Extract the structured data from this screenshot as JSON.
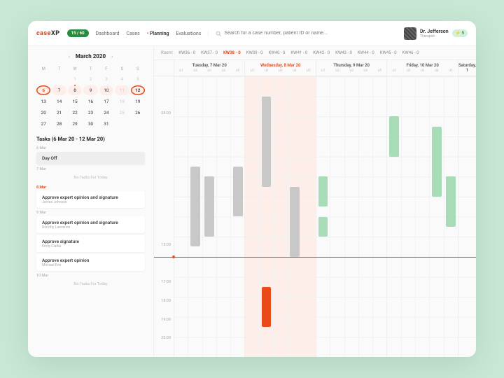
{
  "brand": {
    "part1": "case",
    "part2": "XP"
  },
  "badge_primary": "15 / 60",
  "nav": {
    "dashboard": "Dashboard",
    "cases": "Cases",
    "planning": "Planning",
    "evaluations": "Evaluations"
  },
  "search": {
    "placeholder": "Search for a case number, patient ID or name..."
  },
  "user": {
    "name": "Dr. Jefferson",
    "role": "Therapist",
    "badge": "⚡ 5"
  },
  "calendar": {
    "title": "March 2020",
    "dow": [
      "M",
      "T",
      "W",
      "T",
      "F",
      "S",
      "S"
    ],
    "days": [
      {
        "n": "",
        "t": "blank"
      },
      {
        "n": "",
        "t": "blank"
      },
      {
        "n": "1",
        "t": "muted"
      },
      {
        "n": "2",
        "t": "muted"
      },
      {
        "n": "3",
        "t": "muted"
      },
      {
        "n": "4",
        "t": "muted"
      },
      {
        "n": "5",
        "t": "muted"
      },
      {
        "n": "6",
        "t": "today range"
      },
      {
        "n": "7",
        "t": "range"
      },
      {
        "n": "8",
        "t": "range dot"
      },
      {
        "n": "9",
        "t": "range"
      },
      {
        "n": "10",
        "t": "range"
      },
      {
        "n": "11",
        "t": "range muted"
      },
      {
        "n": "12",
        "t": "selend range"
      },
      {
        "n": "13",
        "t": ""
      },
      {
        "n": "14",
        "t": ""
      },
      {
        "n": "15",
        "t": ""
      },
      {
        "n": "16",
        "t": ""
      },
      {
        "n": "17",
        "t": ""
      },
      {
        "n": "18",
        "t": "muted"
      },
      {
        "n": "19",
        "t": ""
      },
      {
        "n": "20",
        "t": ""
      },
      {
        "n": "21",
        "t": ""
      },
      {
        "n": "22",
        "t": ""
      },
      {
        "n": "23",
        "t": ""
      },
      {
        "n": "24",
        "t": ""
      },
      {
        "n": "25",
        "t": "muted"
      },
      {
        "n": "26",
        "t": ""
      },
      {
        "n": "27",
        "t": ""
      },
      {
        "n": "28",
        "t": ""
      },
      {
        "n": "29",
        "t": ""
      },
      {
        "n": "30",
        "t": ""
      },
      {
        "n": "31",
        "t": ""
      },
      {
        "n": "",
        "t": "blank"
      },
      {
        "n": "",
        "t": "blank"
      }
    ]
  },
  "tasks": {
    "title": "Tasks (6 Mar 20 - 12 Mar 20)",
    "days": [
      {
        "label": "6 Mar",
        "active": false,
        "items": [
          {
            "title": "Day Off",
            "sub": "",
            "muted": true
          }
        ]
      },
      {
        "label": "7 Mar",
        "active": false,
        "empty": "No Tasks For Today"
      },
      {
        "label": "8 Mar",
        "active": true,
        "items": [
          {
            "title": "Approve expert opinion and signature",
            "sub": "James Johnson"
          }
        ]
      },
      {
        "label": "9 Mar",
        "active": false,
        "items": [
          {
            "title": "Approve expert opinion and signature",
            "sub": "Dorothy Lawrence"
          },
          {
            "title": "Approve signature",
            "sub": "Emily Clarke"
          },
          {
            "title": "Approve expert opinion",
            "sub": "Michael Erin"
          }
        ]
      },
      {
        "label": "10 Mar",
        "active": false,
        "empty": "No Tasks For Today"
      }
    ]
  },
  "rooms": {
    "label": "Room:",
    "items": [
      "KW36 - 0",
      "KW37 - 0",
      "KW38 - 0",
      "KW39 - 0",
      "KW40 - 0",
      "KW41 - 0",
      "KW42 - 0",
      "KW43 - 0",
      "KW44 - 0",
      "KW45 - 0",
      "KW46 - 0"
    ],
    "active_index": 2
  },
  "days_header": [
    {
      "name": "Tuesday, 7 Mar 20",
      "subs": [
        "U1",
        "U2",
        "U3",
        "U4",
        "U5"
      ],
      "active": false
    },
    {
      "name": "Wednesday, 8 Mar 20",
      "subs": [
        "U1",
        "U2",
        "U3",
        "U4",
        "U5"
      ],
      "active": true
    },
    {
      "name": "Thursday, 9 Mar 20",
      "subs": [
        "U1",
        "U2",
        "U3",
        "U4",
        "U5"
      ],
      "active": false
    },
    {
      "name": "Friday, 10 Mar 20",
      "subs": [
        "U1",
        "U2",
        "U3",
        "U4",
        "U5"
      ],
      "active": false
    },
    {
      "name": "Saturday, 1",
      "subs": [
        ""
      ],
      "active": false,
      "partial": true
    }
  ],
  "hours": [
    "",
    "",
    "08:00",
    "",
    "",
    "",
    "",
    "",
    "",
    "15:00",
    "",
    "17:00",
    "18:00",
    "19:00",
    "20:00"
  ],
  "nowline_hour": 15,
  "events": [
    {
      "day": 0,
      "sub": 1,
      "start": 10.5,
      "end": 14.5,
      "c": "grey"
    },
    {
      "day": 0,
      "sub": 2,
      "start": 11,
      "end": 14,
      "c": "grey"
    },
    {
      "day": 0,
      "sub": 4,
      "start": 10.5,
      "end": 13,
      "c": "grey"
    },
    {
      "day": 1,
      "sub": 1,
      "start": 7,
      "end": 11.5,
      "c": "grey"
    },
    {
      "day": 1,
      "sub": 1,
      "start": 16.5,
      "end": 18.5,
      "c": "red"
    },
    {
      "day": 1,
      "sub": 3,
      "start": 11.5,
      "end": 15,
      "c": "grey"
    },
    {
      "day": 2,
      "sub": 0,
      "start": 11,
      "end": 12.5,
      "c": "green"
    },
    {
      "day": 2,
      "sub": 0,
      "start": 13,
      "end": 14,
      "c": "green"
    },
    {
      "day": 3,
      "sub": 0,
      "start": 8,
      "end": 10,
      "c": "green"
    },
    {
      "day": 3,
      "sub": 3,
      "start": 8.5,
      "end": 12,
      "c": "green"
    },
    {
      "day": 3,
      "sub": 4,
      "start": 11,
      "end": 13.5,
      "c": "green"
    }
  ],
  "grid": {
    "start": 6,
    "end": 20
  }
}
